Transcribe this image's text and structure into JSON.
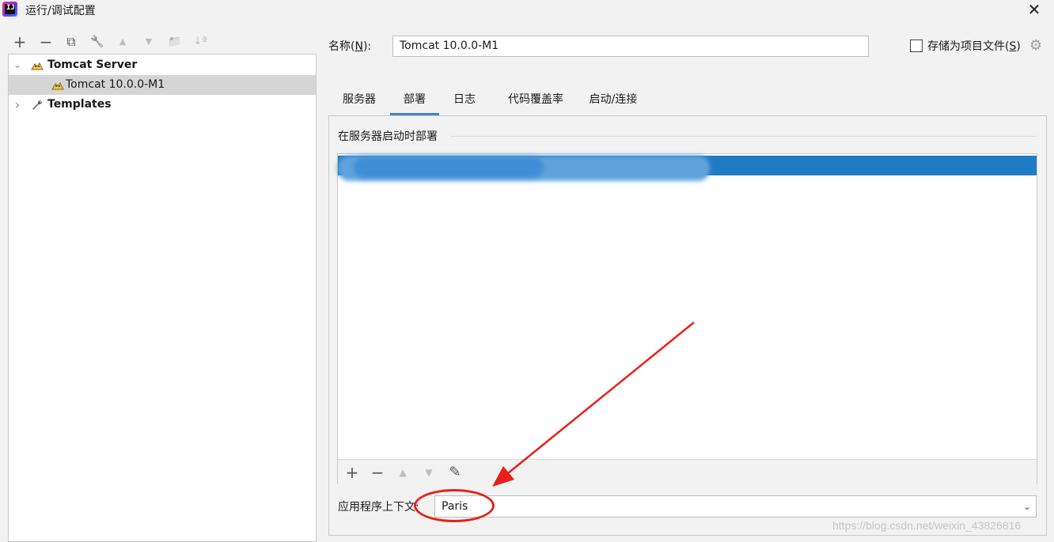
{
  "window": {
    "title": "运行/调试配置",
    "logo_text": "IJ",
    "close_glyph": "✕"
  },
  "left_toolbar": {
    "add": "+",
    "remove": "−",
    "copy": "⧉",
    "edit": "🔧",
    "up": "▲",
    "down": "▼",
    "folder": "📁",
    "sort": "↓ª"
  },
  "tree": {
    "items": [
      {
        "label": "Tomcat Server",
        "icon": "tomcat-icon",
        "expanded": true
      },
      {
        "label": "Tomcat 10.0.0-M1",
        "icon": "tomcat-icon",
        "selected": true
      },
      {
        "label": "Templates",
        "icon": "wrench-icon",
        "expanded": false
      }
    ],
    "chevron_down": "⌄",
    "chevron_right": "›"
  },
  "form": {
    "name_label": "名称(",
    "name_mnemonic": "N",
    "name_label_end": "):",
    "name_value": "Tomcat 10.0.0-M1",
    "store_label": "存储为项目文件(",
    "store_mnemonic": "S",
    "store_label_end": ")",
    "store_checked": false
  },
  "tabs": [
    {
      "label": "服务器"
    },
    {
      "label": "部署",
      "active": true
    },
    {
      "label": "日志"
    },
    {
      "label": "代码覆盖率"
    },
    {
      "label": "启动/连接"
    }
  ],
  "deploy": {
    "section_title": "在服务器启动时部署",
    "list_toolbar": {
      "add": "+",
      "remove": "−",
      "up": "▲",
      "down": "▼",
      "edit": "✎"
    },
    "context_label": "应用程序上下文:",
    "context_value": "Paris"
  },
  "watermark": "https://blog.csdn.net/weixin_43826816",
  "colors": {
    "accent": "#4083c9",
    "selection": "#1f7bc4",
    "annotation": "#e8201b"
  }
}
